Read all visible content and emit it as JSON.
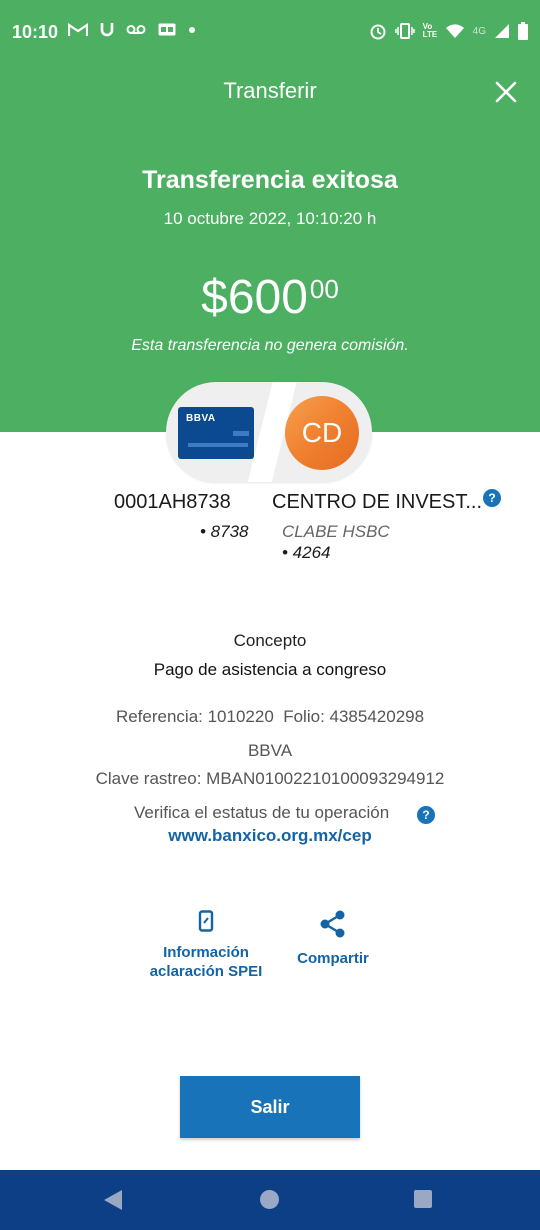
{
  "status_bar": {
    "time": "10:10",
    "left_icons": [
      "gmail-icon",
      "u-icon",
      "voicemail-icon",
      "ge-icon",
      "dot-icon"
    ],
    "right_icons": [
      "alarm-icon",
      "vibrate-icon",
      "volte-icon",
      "wifi-icon",
      "signal-icon",
      "battery-icon"
    ],
    "network": "4G",
    "volte": "Vo LTE"
  },
  "header": {
    "title": "Transferir",
    "headline": "Transferencia exitosa",
    "timestamp": "10 octubre 2022, 10:10:20 h",
    "amount_main": "$600",
    "amount_cents": "00",
    "fee_note": "Esta transferencia no genera comisión."
  },
  "from": {
    "card_brand": "BBVA",
    "account": "0001AH8738",
    "last4": "• 8738"
  },
  "to": {
    "initials": "CD",
    "name": "CENTRO DE INVEST...",
    "help": "?",
    "account_type": "CLABE HSBC",
    "last4": "• 4264"
  },
  "details": {
    "concept_label": "Concepto",
    "concept_value": "Pago de asistencia a congreso",
    "ref_folio": "Referencia: 1010220  Folio: 4385420298",
    "bank": "BBVA",
    "tracking": "Clave rastreo: MBAN01002210100093294912",
    "verify_text": "Verifica el estatus de tu operación",
    "verify_help": "?",
    "verify_link": "www.banxico.org.mx/cep"
  },
  "actions": {
    "spei_line1": "Información",
    "spei_line2": "aclaración SPEI",
    "share": "Compartir"
  },
  "exit_label": "Salir",
  "colors": {
    "header_green": "#4caf61",
    "accent_blue": "#1973b8",
    "link_blue": "#1464a5",
    "nav_blue": "#0d3f87",
    "avatar_orange": "#f08030"
  }
}
